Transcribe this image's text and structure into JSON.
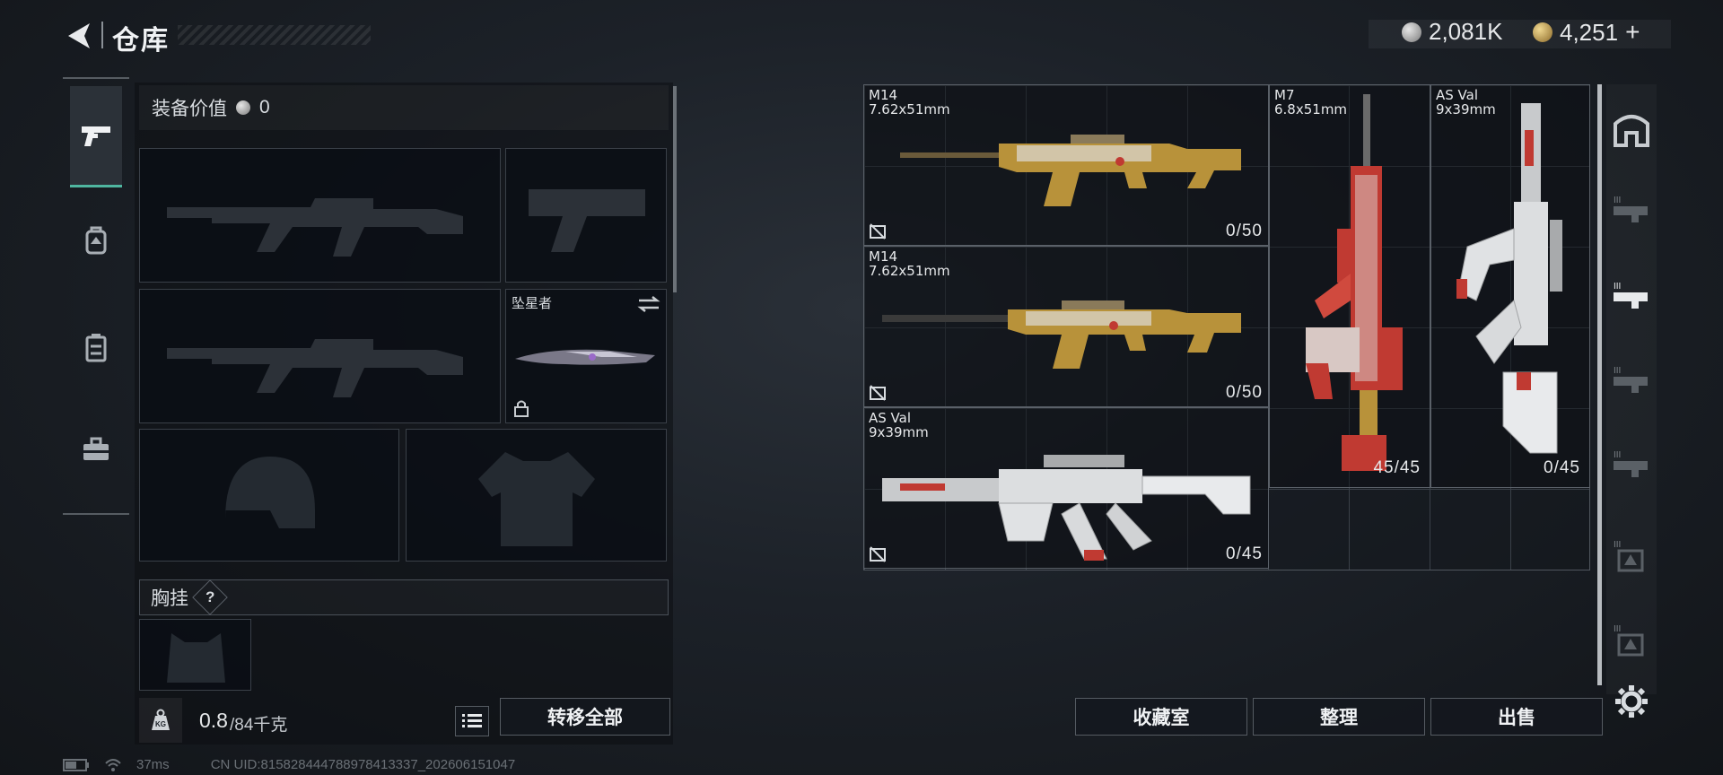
{
  "header": {
    "title": "仓库",
    "currency_silver": "2,081K",
    "currency_gold": "4,251",
    "gold_add": "+"
  },
  "left_tabs": [
    {
      "name": "pistol-icon",
      "active": true
    },
    {
      "name": "backpack-icon",
      "active": false
    },
    {
      "name": "chest-rig-icon",
      "active": false
    },
    {
      "name": "toolbox-icon",
      "active": false
    }
  ],
  "equipment": {
    "value_label": "装备价值",
    "value": "0",
    "melee_name": "坠星者",
    "chest_rig_label": "胸挂",
    "help": "?",
    "weight_current": "0.8",
    "weight_max": "/84千克",
    "weight_icon_text": "KG",
    "transfer_all": "转移全部"
  },
  "stash": {
    "items": [
      {
        "name": "M14",
        "caliber": "7.62x51mm",
        "count": "0/50"
      },
      {
        "name": "M14",
        "caliber": "7.62x51mm",
        "count": "0/50"
      },
      {
        "name": "AS Val",
        "caliber": "9x39mm",
        "count": "0/45"
      },
      {
        "name": "M7",
        "caliber": "6.8x51mm",
        "count": "45/45"
      },
      {
        "name": "AS Val",
        "caliber": "9x39mm",
        "count": "0/45"
      }
    ],
    "buttons": {
      "collection": "收藏室",
      "organize": "整理",
      "sell": "出售"
    }
  },
  "status_bar": {
    "ping": "37ms",
    "uid": "CN UID:815828444788978413337_202606151047"
  },
  "colors": {
    "accent": "#4fb6a0",
    "gold_skin": "#b8923a",
    "red_skin": "#c03a32",
    "white_skin": "#d8dadc"
  }
}
